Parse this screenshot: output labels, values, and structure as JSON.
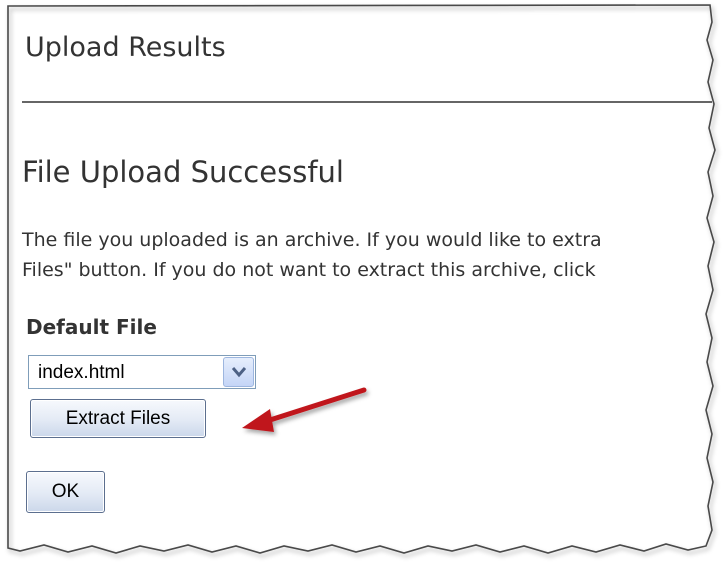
{
  "page": {
    "title": "Upload Results",
    "heading": "File Upload Successful",
    "message_lines": [
      "The file you uploaded is an archive. If you would like to extra",
      "Files\" button. If you do not want to extract this archive, click"
    ]
  },
  "form": {
    "default_file_label": "Default File",
    "default_file_select": {
      "selected": "index.html",
      "icon": "chevron-down-icon"
    },
    "extract_button_label": "Extract Files",
    "ok_button_label": "OK"
  },
  "annotation": {
    "arrow_color": "#c0181e",
    "arrow_icon": "red-arrow-pointer"
  },
  "colors": {
    "text": "#333333",
    "rule": "#666666",
    "select_border": "#7f9db9",
    "button_border": "#5c6f8f"
  }
}
